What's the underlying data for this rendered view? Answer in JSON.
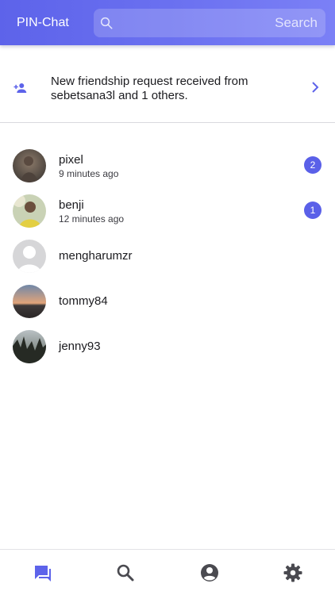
{
  "header": {
    "title": "PIN-Chat",
    "search_placeholder": "Search",
    "search_value": ""
  },
  "friend_request": {
    "icon": "person-add-icon",
    "text": "New friendship request received from sebetsana3l and 1 others.",
    "chevron_icon": "chevron-right-icon"
  },
  "chats": [
    {
      "name": "pixel",
      "time": "9 minutes ago",
      "unread": "2",
      "avatar": "photo-person-outdoors"
    },
    {
      "name": "benji",
      "time": "12 minutes ago",
      "unread": "1",
      "avatar": "photo-person-yellow-shirt"
    },
    {
      "name": "mengharumzr",
      "time": "",
      "unread": "",
      "avatar": "default-avatar"
    },
    {
      "name": "tommy84",
      "time": "",
      "unread": "",
      "avatar": "photo-sunset-landscape"
    },
    {
      "name": "jenny93",
      "time": "",
      "unread": "",
      "avatar": "photo-trees-silhouette"
    }
  ],
  "bottom_nav": [
    {
      "name": "chats",
      "icon": "chat-bubbles-icon",
      "active": true
    },
    {
      "name": "search",
      "icon": "search-icon",
      "active": false
    },
    {
      "name": "profile",
      "icon": "account-circle-icon",
      "active": false
    },
    {
      "name": "settings",
      "icon": "gear-icon",
      "active": false
    }
  ],
  "colors": {
    "accent": "#5d63ea",
    "badge": "#5a60e8",
    "inactive_icon": "#4a4a50"
  }
}
